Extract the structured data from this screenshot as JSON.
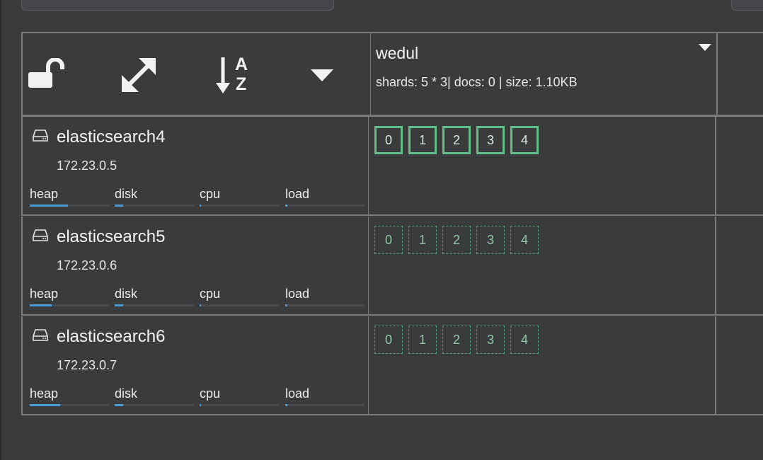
{
  "header": {
    "controls": [
      {
        "icon": "unlock-icon"
      },
      {
        "icon": "expand-icon"
      },
      {
        "icon": "sort-alpha-icon",
        "glyph_top": "A",
        "glyph_bottom": "Z"
      },
      {
        "icon": "caret-down-icon"
      }
    ],
    "index": {
      "name": "wedul",
      "meta": "shards: 5 * 3| docs: 0 | size: 1.10KB"
    }
  },
  "nodes": [
    {
      "name": "elasticsearch4",
      "ip": "172.23.0.5",
      "stats": [
        {
          "label": "heap",
          "value": 0.48
        },
        {
          "label": "disk",
          "value": 0.11
        },
        {
          "label": "cpu",
          "value": 0.02
        },
        {
          "label": "load",
          "value": 0.03
        }
      ],
      "shards": {
        "type": "primary",
        "ids": [
          "0",
          "1",
          "2",
          "3",
          "4"
        ]
      }
    },
    {
      "name": "elasticsearch5",
      "ip": "172.23.0.6",
      "stats": [
        {
          "label": "heap",
          "value": 0.28
        },
        {
          "label": "disk",
          "value": 0.11
        },
        {
          "label": "cpu",
          "value": 0.02
        },
        {
          "label": "load",
          "value": 0.03
        }
      ],
      "shards": {
        "type": "replica",
        "ids": [
          "0",
          "1",
          "2",
          "3",
          "4"
        ]
      }
    },
    {
      "name": "elasticsearch6",
      "ip": "172.23.0.7",
      "stats": [
        {
          "label": "heap",
          "value": 0.38
        },
        {
          "label": "disk",
          "value": 0.11
        },
        {
          "label": "cpu",
          "value": 0.02
        },
        {
          "label": "load",
          "value": 0.03
        }
      ],
      "shards": {
        "type": "replica",
        "ids": [
          "0",
          "1",
          "2",
          "3",
          "4"
        ]
      }
    }
  ],
  "colors": {
    "background": "#3a3b3d",
    "grid_line": "#7a7b7e",
    "primary_shard": "#5fc08a",
    "replica_shard": "#4fa574",
    "stat_fill": "#4a9bd6"
  }
}
